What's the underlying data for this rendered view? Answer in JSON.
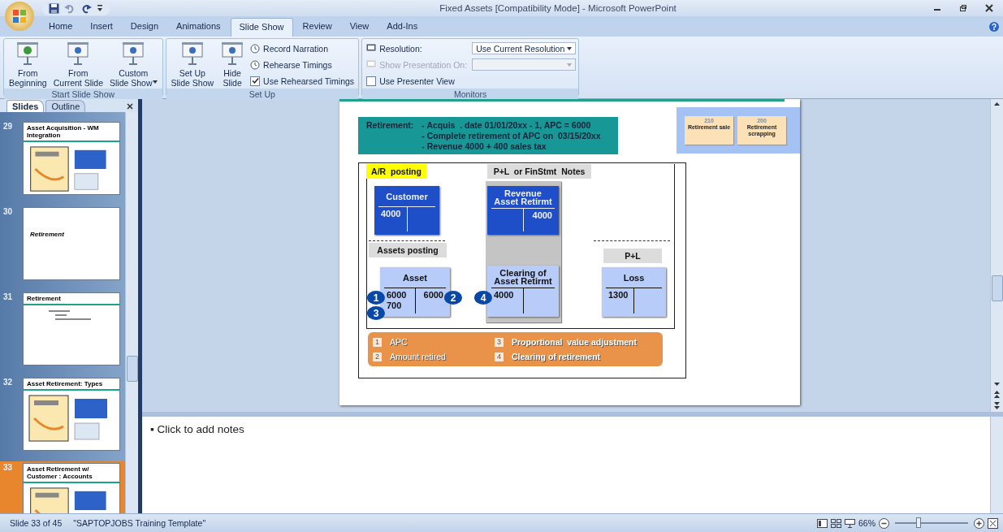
{
  "window": {
    "title": "Fixed Assets [Compatibility Mode] - Microsoft PowerPoint"
  },
  "ribbon_tabs": [
    {
      "label": "Home",
      "selected": false
    },
    {
      "label": "Insert",
      "selected": false
    },
    {
      "label": "Design",
      "selected": false
    },
    {
      "label": "Animations",
      "selected": false
    },
    {
      "label": "Slide Show",
      "selected": true
    },
    {
      "label": "Review",
      "selected": false
    },
    {
      "label": "View",
      "selected": false
    },
    {
      "label": "Add-Ins",
      "selected": false
    }
  ],
  "ribbon_groups": [
    {
      "label": "Start Slide Show",
      "large": [
        {
          "lines": [
            "From",
            "Beginning"
          ]
        },
        {
          "lines": [
            "From",
            "Current Slide"
          ]
        },
        {
          "lines": [
            "Custom",
            "Slide Show"
          ],
          "menu": true
        }
      ]
    },
    {
      "label": "Set Up",
      "large": [
        {
          "lines": [
            "Set Up",
            "Slide Show"
          ]
        },
        {
          "lines": [
            "Hide",
            "Slide"
          ]
        }
      ],
      "small": [
        {
          "kind": "button",
          "label": "Record Narration"
        },
        {
          "kind": "button",
          "label": "Rehearse Timings"
        },
        {
          "kind": "check",
          "label": "Use Rehearsed Timings",
          "checked": true
        }
      ]
    },
    {
      "label": "Monitors",
      "small": [
        {
          "kind": "select",
          "label": "Resolution:",
          "value": "Use Current Resolution",
          "disabled": false
        },
        {
          "kind": "select",
          "label": "Show Presentation On:",
          "disabled": true
        },
        {
          "kind": "check",
          "label": "Use Presenter View",
          "checked": false
        }
      ]
    }
  ],
  "pane_tabs": [
    {
      "label": "Slides",
      "selected": true
    },
    {
      "label": "Outline",
      "selected": false
    }
  ],
  "slides": [
    {
      "number": "29",
      "kind": "diagram",
      "title": "Asset Acquisition - WM Integration",
      "selected": false
    },
    {
      "number": "30",
      "kind": "section",
      "title": "Retirement",
      "selected": false
    },
    {
      "number": "31",
      "kind": "text",
      "title": "Retirement",
      "selected": false
    },
    {
      "number": "32",
      "kind": "diagram",
      "title": "Asset Retirement: Types",
      "selected": false
    },
    {
      "number": "33",
      "kind": "diagram",
      "title": "Asset Retirement w/ Customer : Accounts",
      "selected": true
    }
  ],
  "slide": {
    "summary": {
      "label": "Retirement:",
      "lines": [
        "- Acquis  . date 01/01/20xx - 1, APC = 6000",
        "- Complete retirement of APC on  03/15/20xx",
        "- Revenue 4000 + 400 sales tax"
      ]
    },
    "transaction_types": [
      {
        "code": "210",
        "name": "Retirement sale"
      },
      {
        "code": "200",
        "name": "Retirement scrapping"
      }
    ],
    "sections": [
      {
        "kind": "highlight",
        "label": "A/R  posting"
      },
      {
        "kind": "plain",
        "label": "P+L  or FinStmt  Notes"
      },
      {
        "kind": "plain",
        "label": "Assets posting"
      },
      {
        "kind": "plain",
        "label": "P+L"
      }
    ],
    "accounts": [
      {
        "kind": "dark",
        "lines": [
          "Customer"
        ],
        "debit": [
          "4000"
        ]
      },
      {
        "kind": "dark",
        "lines": [
          "Revenue",
          "Asset Retirmt"
        ],
        "credit": [
          "4000"
        ]
      },
      {
        "kind": "light",
        "lines": [
          "Asset"
        ],
        "debit": [
          "6000",
          "700"
        ],
        "credit": [
          "6000"
        ]
      },
      {
        "kind": "light",
        "lines": [
          "Clearing of",
          "Asset Retirmt"
        ],
        "debit": [
          "4000"
        ]
      },
      {
        "kind": "light",
        "lines": [
          "Loss"
        ],
        "debit": [
          "1300"
        ]
      }
    ],
    "steps": [
      "1",
      "2",
      "4",
      "3"
    ],
    "legend": [
      {
        "number": "1",
        "text": "APC"
      },
      {
        "number": "2",
        "text": "Amount retired"
      },
      {
        "number": "3",
        "text": "Proportional  value adjustment"
      },
      {
        "number": "4",
        "text": "Clearing of retirement"
      }
    ]
  },
  "notes": {
    "bullet": "▪",
    "placeholder": "Click to add notes"
  },
  "status_bar": {
    "slide": "Slide 33 of 45",
    "theme": "\"SAPTOPJOBS Training Template\"",
    "zoom": "66%",
    "zoom_slider": {
      "level": 0.32
    }
  }
}
